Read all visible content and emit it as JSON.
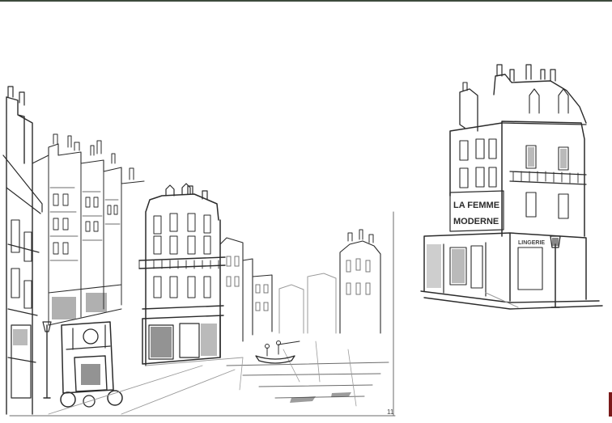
{
  "artwork": {
    "street_scene": {
      "corner_number": "11"
    },
    "shop_building": {
      "facade_sign": [
        "LA FEMME",
        "MODERNE"
      ],
      "shop_lettering": "LINGERIE"
    },
    "colors": {
      "paper": "#ffffff",
      "ink": "#2b2b2b",
      "top_rule": "#3d4a3c",
      "edge_mark": "#7a1a1a"
    }
  }
}
